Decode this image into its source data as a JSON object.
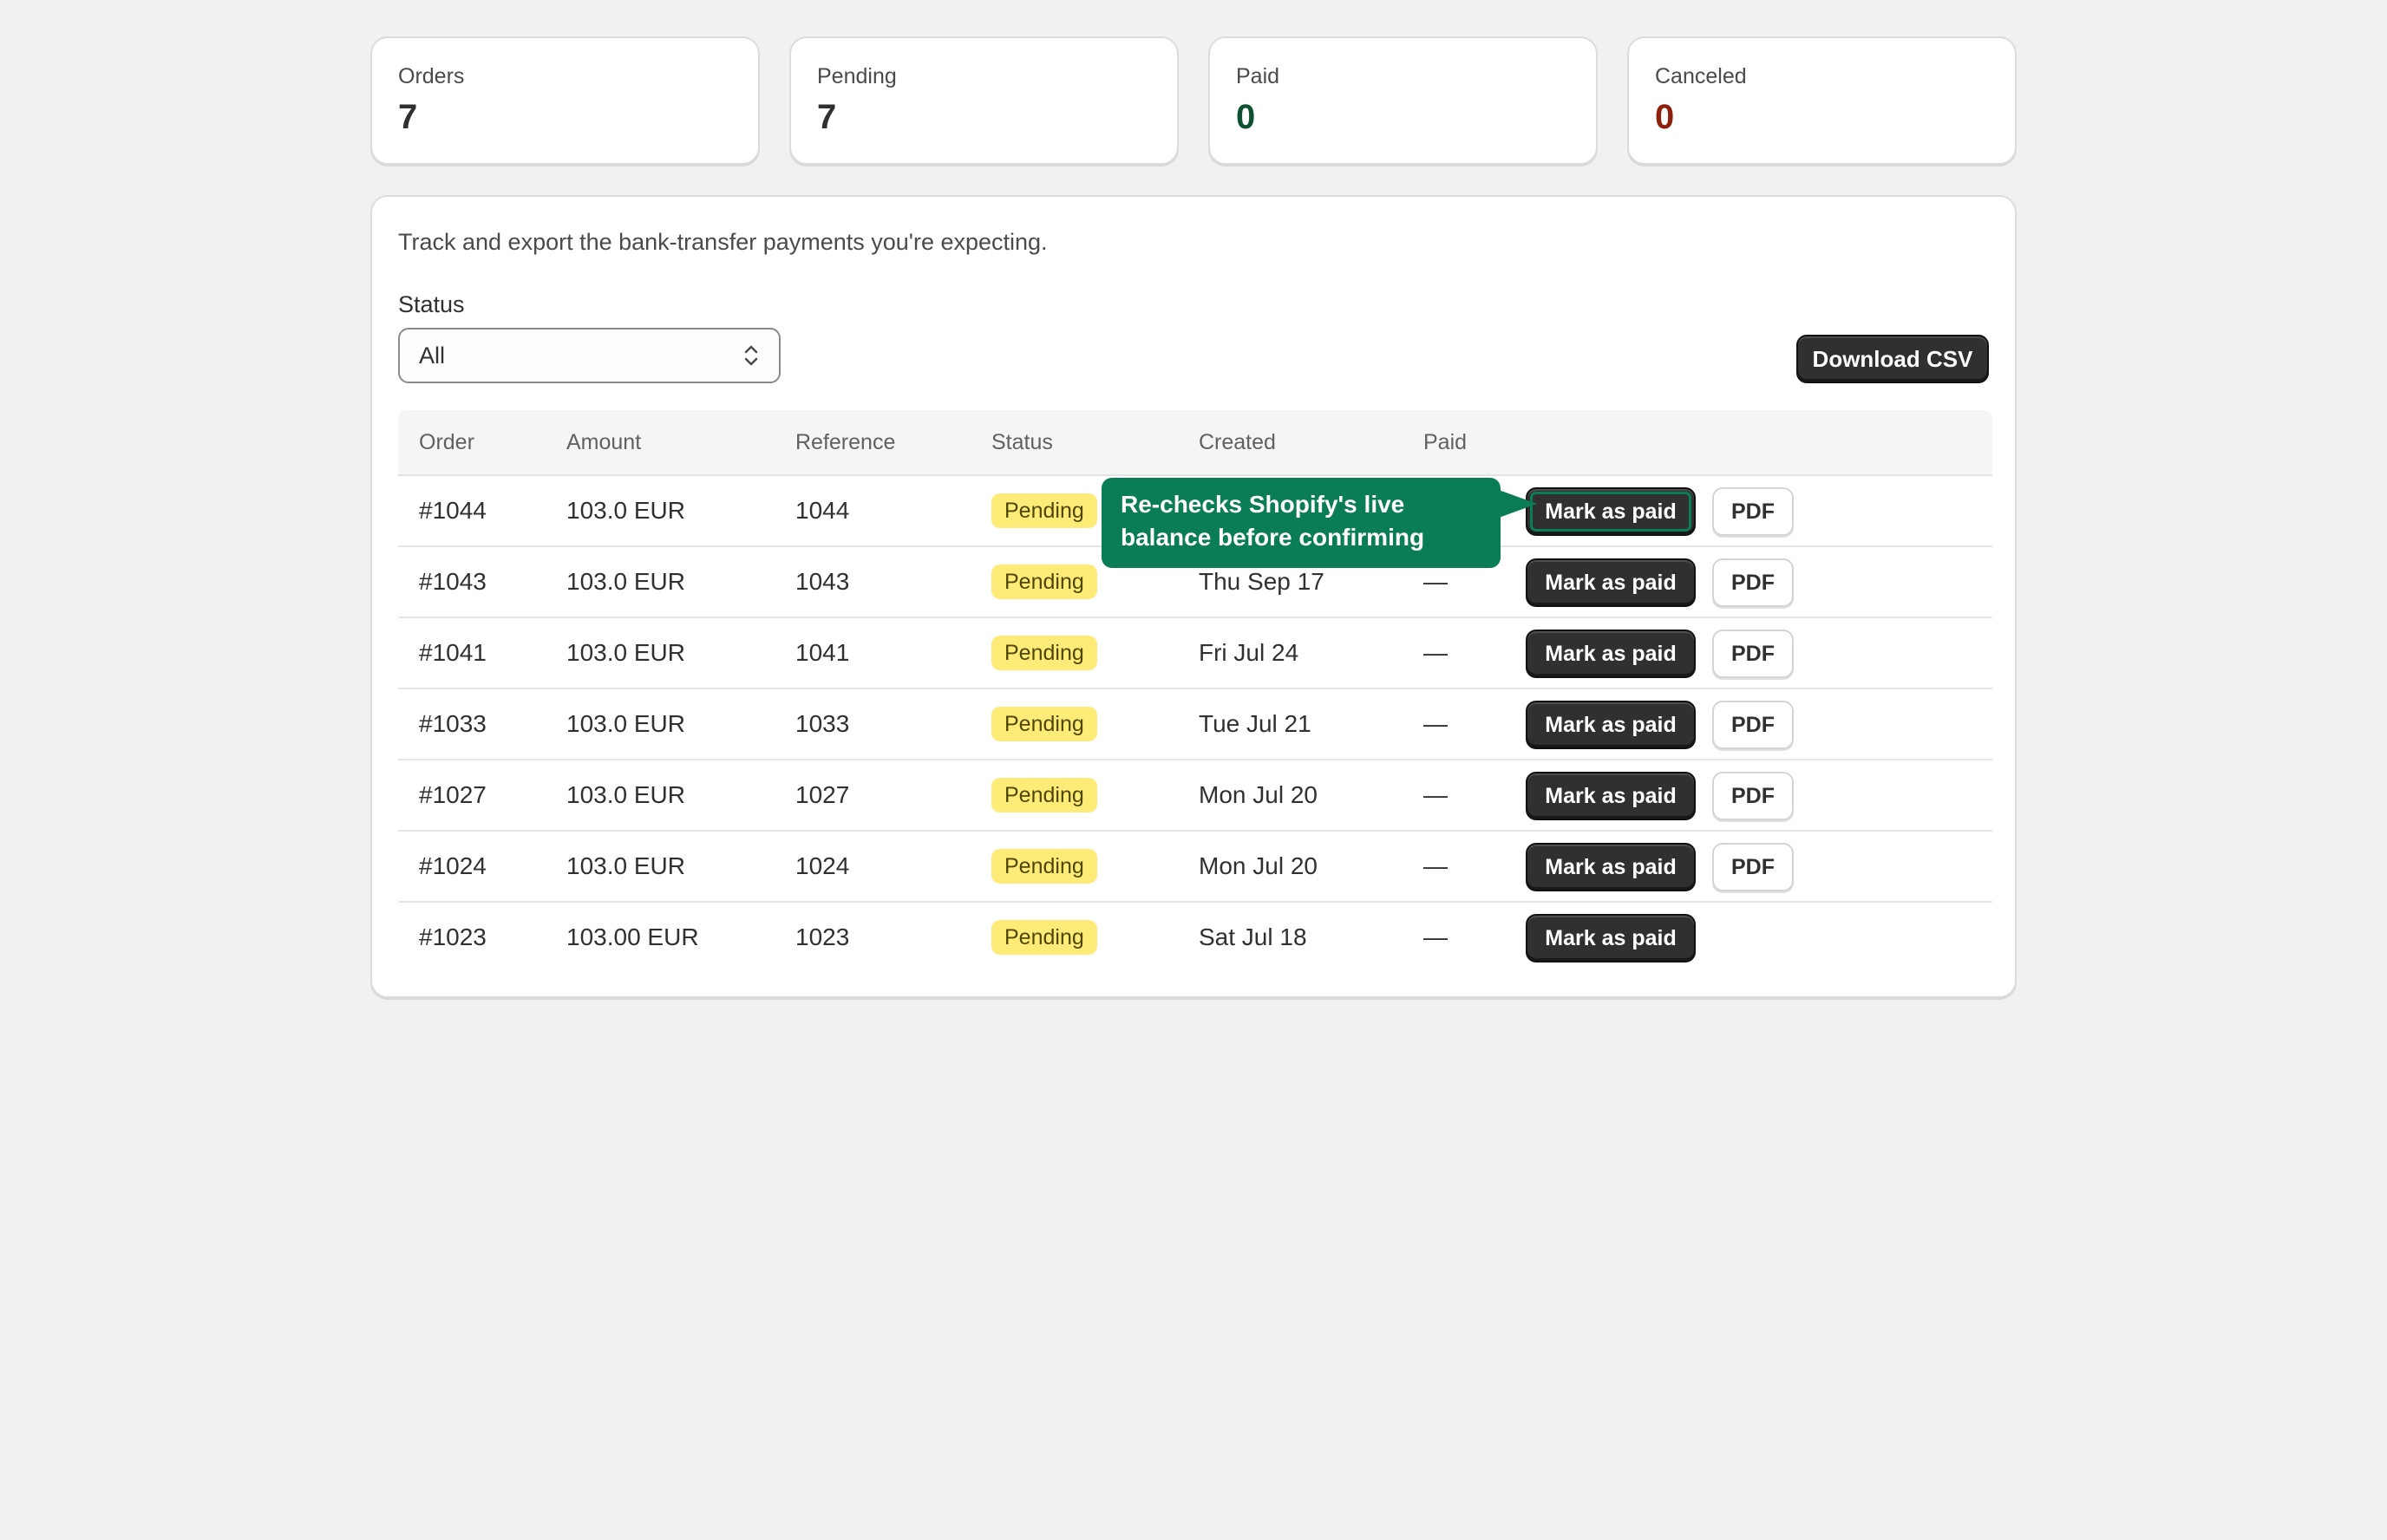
{
  "stats": [
    {
      "label": "Orders",
      "value": "7"
    },
    {
      "label": "Pending",
      "value": "7"
    },
    {
      "label": "Paid",
      "value": "0"
    },
    {
      "label": "Canceled",
      "value": "0"
    }
  ],
  "panel": {
    "description": "Track and export the bank-transfer payments you're expecting."
  },
  "filter": {
    "label": "Status",
    "value": "All"
  },
  "toolbar": {
    "download_csv_label": "Download CSV"
  },
  "table": {
    "headers": [
      "Order",
      "Amount",
      "Reference",
      "Status",
      "Created",
      "Paid"
    ],
    "rows": [
      {
        "order": "#1044",
        "amount": "103.0 EUR",
        "reference": "1044",
        "status": "Pending",
        "created": "",
        "paid": "",
        "mark_label": "Mark as paid",
        "pdf_label": "PDF"
      },
      {
        "order": "#1043",
        "amount": "103.0 EUR",
        "reference": "1043",
        "status": "Pending",
        "created": "Thu Sep 17",
        "paid": "—",
        "mark_label": "Mark as paid",
        "pdf_label": "PDF"
      },
      {
        "order": "#1041",
        "amount": "103.0 EUR",
        "reference": "1041",
        "status": "Pending",
        "created": "Fri Jul 24",
        "paid": "—",
        "mark_label": "Mark as paid",
        "pdf_label": "PDF"
      },
      {
        "order": "#1033",
        "amount": "103.0 EUR",
        "reference": "1033",
        "status": "Pending",
        "created": "Tue Jul 21",
        "paid": "—",
        "mark_label": "Mark as paid",
        "pdf_label": "PDF"
      },
      {
        "order": "#1027",
        "amount": "103.0 EUR",
        "reference": "1027",
        "status": "Pending",
        "created": "Mon Jul 20",
        "paid": "—",
        "mark_label": "Mark as paid",
        "pdf_label": "PDF"
      },
      {
        "order": "#1024",
        "amount": "103.0 EUR",
        "reference": "1024",
        "status": "Pending",
        "created": "Mon Jul 20",
        "paid": "—",
        "mark_label": "Mark as paid",
        "pdf_label": "PDF"
      },
      {
        "order": "#1023",
        "amount": "103.00 EUR",
        "reference": "1023",
        "status": "Pending",
        "created": "Sat Jul 18",
        "paid": "—",
        "mark_label": "Mark as paid",
        "pdf_label": ""
      }
    ]
  },
  "tooltip": {
    "text": "Re-checks Shopify's live balance before confirming"
  },
  "colors": {
    "background": "#f1f1f1",
    "primary_button": "#303030",
    "pending_badge": "#ffeb78",
    "paid_value": "#0f5132",
    "canceled_value": "#8e1f0b",
    "tooltip": "#0b7d55"
  },
  "icons": {
    "select": "selector-icon"
  }
}
